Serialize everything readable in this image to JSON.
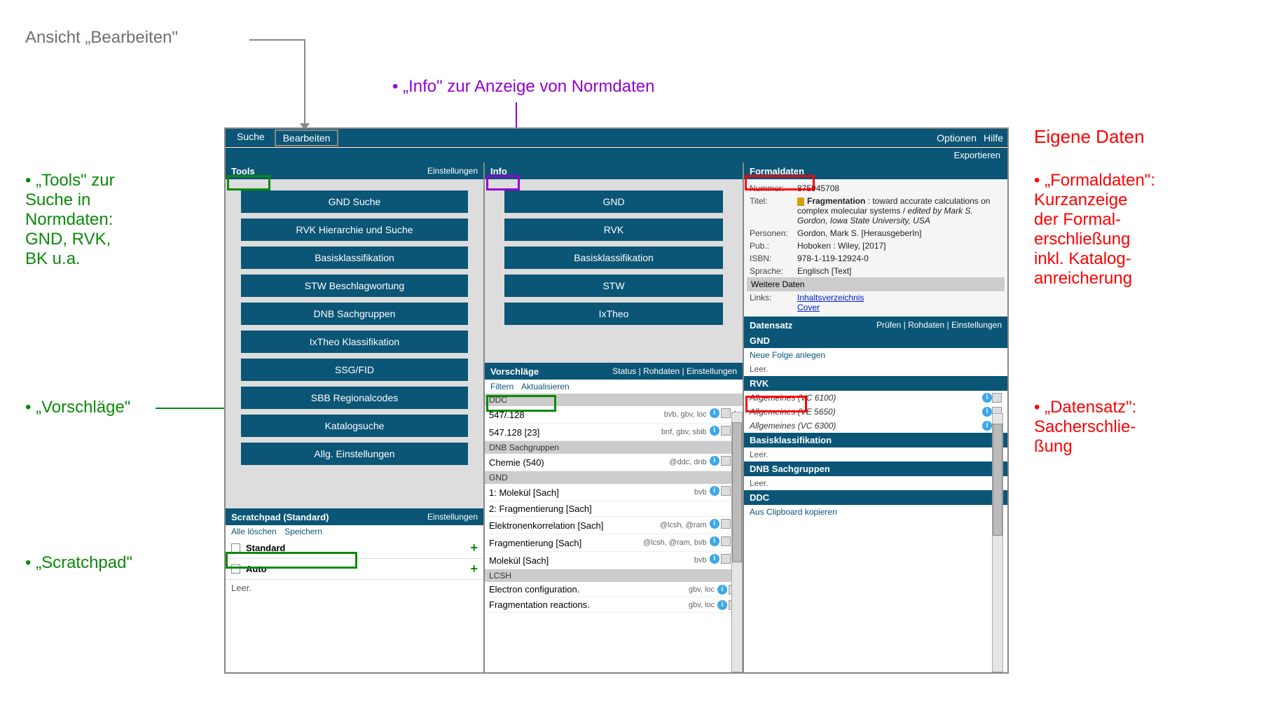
{
  "annotations": {
    "heading_gray": "Ansicht „Bearbeiten\"",
    "heading_purple": "• „Info\" zur Anzeige von Normdaten",
    "left1_l1": "• „Tools\" zur",
    "left1_l2": "Suche in",
    "left1_l3": "Normdaten:",
    "left1_l4": "GND, RVK,",
    "left1_l5": "BK u.a.",
    "left2": "• „Vorschläge\"",
    "left3": "• „Scratchpad\"",
    "right_heading": "Eigene Daten",
    "right1_l1": "• „Formaldaten\":",
    "right1_l2": "Kurzanzeige",
    "right1_l3": "der Formal-",
    "right1_l4": "erschließung",
    "right1_l5": "inkl. Katalog-",
    "right1_l6": "anreicherung",
    "right2_l1": "• „Datensatz\":",
    "right2_l2": "Sacherschlie-",
    "right2_l3": "ßung"
  },
  "topbar": {
    "suche": "Suche",
    "bearbeiten": "Bearbeiten",
    "optionen": "Optionen",
    "hilfe": "Hilfe",
    "exportieren": "Exportieren"
  },
  "tools": {
    "title": "Tools",
    "einstellungen": "Einstellungen",
    "buttons": [
      "GND Suche",
      "RVK Hierarchie und Suche",
      "Basisklassifikation",
      "STW Beschlagwortung",
      "DNB Sachgruppen",
      "IxTheo Klassifikation",
      "SSG/FID",
      "SBB Regionalcodes",
      "Katalogsuche",
      "Allg. Einstellungen"
    ]
  },
  "scratchpad": {
    "title": "Scratchpad (Standard)",
    "einstellungen": "Einstellungen",
    "alle_loeschen": "Alle löschen",
    "speichern": "Speichern",
    "items": [
      "Standard",
      "Auto"
    ],
    "leer": "Leer."
  },
  "info": {
    "title": "Info",
    "buttons": [
      "GND",
      "RVK",
      "Basisklassifikation",
      "STW",
      "IxTheo"
    ]
  },
  "vorschlaege": {
    "title": "Vorschläge",
    "status": "Status",
    "sep": " | ",
    "rohdaten": "Rohdaten",
    "einstellungen": "Einstellungen",
    "filtern": "Filtern",
    "aktualisieren": "Aktualisieren",
    "groups": [
      {
        "h": "DDC",
        "rows": [
          {
            "code": "547/.128",
            "src": "bvb, gbv, loc",
            "icons": true
          },
          {
            "code": "547.128 [23]",
            "src": "bnf, gbv, sbib",
            "icons": true
          }
        ]
      },
      {
        "h": "DNB Sachgruppen",
        "rows": [
          {
            "code": "Chemie (540)",
            "src": "@ddc, dnb",
            "icons": true
          }
        ]
      },
      {
        "h": "GND",
        "rows": [
          {
            "code": "1: Molekül [Sach]",
            "src": "bvb",
            "icons": true
          },
          {
            "code": "2: Fragmentierung [Sach]",
            "src": "",
            "icons": false
          },
          {
            "code": "Elektronenkorrelation [Sach]",
            "src": "@lcsh, @ram",
            "icons": true
          },
          {
            "code": "Fragmentierung [Sach]",
            "src": "@lcsh, @ram, bvb",
            "icons": true
          },
          {
            "code": "Molekül [Sach]",
            "src": "bvb",
            "icons": true
          }
        ]
      },
      {
        "h": "LCSH",
        "rows": [
          {
            "code": "Electron configuration.",
            "src": "gbv, loc",
            "icons": true,
            "noPlus": true
          },
          {
            "code": "Fragmentation reactions.",
            "src": "gbv, loc",
            "icons": true,
            "noPlus": true
          }
        ]
      }
    ]
  },
  "formaldaten": {
    "title": "Formaldaten",
    "nummer_label": "Nummer:",
    "nummer": "875945708",
    "titel_label": "Titel:",
    "titel_bold": "Fragmentation",
    "titel_rest": " : toward accurate calculations on complex molecular systems / ",
    "titel_it": "edited by Mark S. Gordon, Iowa State University, USA",
    "personen_label": "Personen:",
    "personen": "Gordon, Mark S. [HerausgeberIn]",
    "pub_label": "Pub.:",
    "pub": "Hoboken : Wiley, [2017]",
    "isbn_label": "ISBN:",
    "isbn": "978-1-119-12924-0",
    "sprache_label": "Sprache:",
    "sprache": "Englisch [Text]",
    "weitere": "Weitere Daten",
    "links_label": "Links:",
    "link1": "Inhaltsverzeichnis",
    "link2": "Cover"
  },
  "datensatz": {
    "title": "Datensatz",
    "pruefen": "Prüfen",
    "rohdaten": "Rohdaten",
    "einstellungen": "Einstellungen",
    "sep": " | ",
    "groups": [
      {
        "h": "GND",
        "rows": [
          {
            "t": "Neue Folge anlegen",
            "link": true
          }
        ],
        "leer": "Leer."
      },
      {
        "h": "RVK",
        "rows": [
          {
            "t": "Allgemeines (VC 6100)",
            "it": true,
            "icons": true
          },
          {
            "t": "Allgemeines (VE 5650)",
            "it": true,
            "icons": true
          },
          {
            "t": "Allgemeines (VC 6300)",
            "it": true,
            "icons": true
          }
        ]
      },
      {
        "h": "Basisklassifikation",
        "leer": "Leer."
      },
      {
        "h": "DNB Sachgruppen",
        "leer": "Leer."
      },
      {
        "h": "DDC",
        "rows": [
          {
            "t": "Aus Clipboard kopieren",
            "link": true
          }
        ]
      }
    ]
  }
}
